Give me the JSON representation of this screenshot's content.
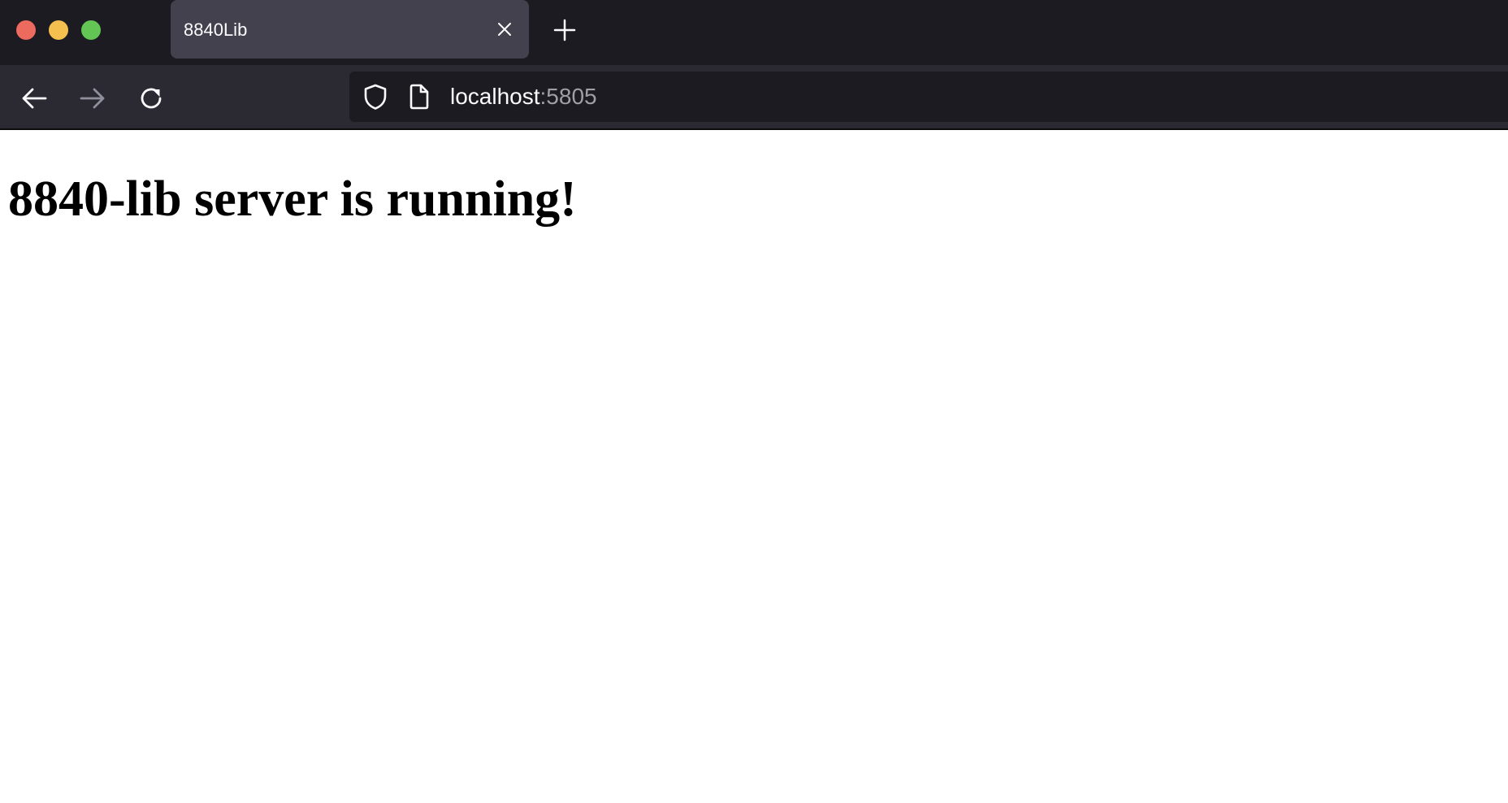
{
  "window": {
    "controls": [
      "close",
      "minimize",
      "maximize"
    ]
  },
  "tabs": [
    {
      "title": "8840Lib",
      "active": true
    }
  ],
  "toolbar": {
    "new_tab_icon": "plus-icon",
    "back_icon": "arrow-left-icon",
    "forward_icon": "arrow-right-icon",
    "reload_icon": "reload-icon"
  },
  "address_bar": {
    "host": "localhost",
    "port": ":5805",
    "security_icon": "shield-icon",
    "page_icon": "document-icon"
  },
  "page": {
    "heading": "8840-lib server is running!"
  },
  "colors": {
    "tab_strip": "#1c1b22",
    "active_tab": "#42414d",
    "nav_bar": "#2b2a33",
    "url_field": "#1c1b22",
    "close_dot": "#ed6a5e",
    "minimize_dot": "#f5bf4f",
    "maximize_dot": "#62c554",
    "page_background": "#ffffff"
  }
}
